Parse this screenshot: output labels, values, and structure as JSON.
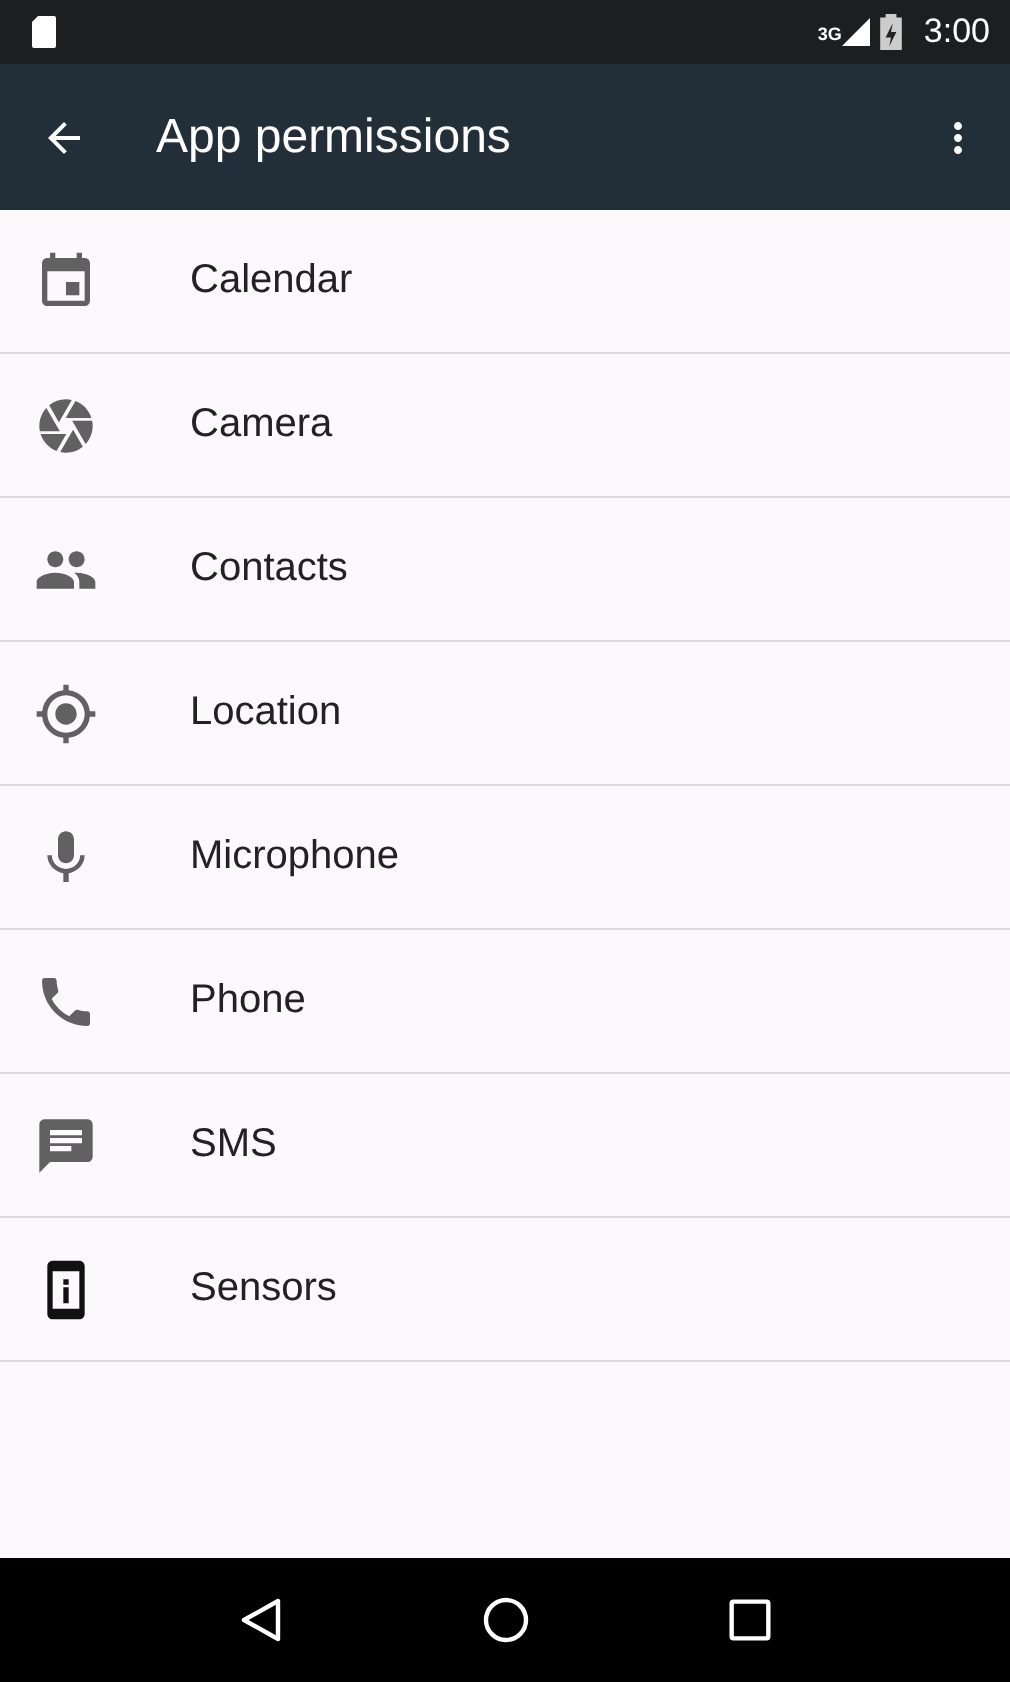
{
  "status_bar": {
    "network": "3G",
    "time": "3:00"
  },
  "toolbar": {
    "title": "App permissions"
  },
  "items": [
    {
      "kind": "calendar",
      "label": "Calendar"
    },
    {
      "kind": "camera",
      "label": "Camera"
    },
    {
      "kind": "contacts",
      "label": "Contacts"
    },
    {
      "kind": "location",
      "label": "Location"
    },
    {
      "kind": "microphone",
      "label": "Microphone"
    },
    {
      "kind": "phone",
      "label": "Phone"
    },
    {
      "kind": "sms",
      "label": "SMS"
    },
    {
      "kind": "sensors",
      "label": "Sensors"
    }
  ]
}
